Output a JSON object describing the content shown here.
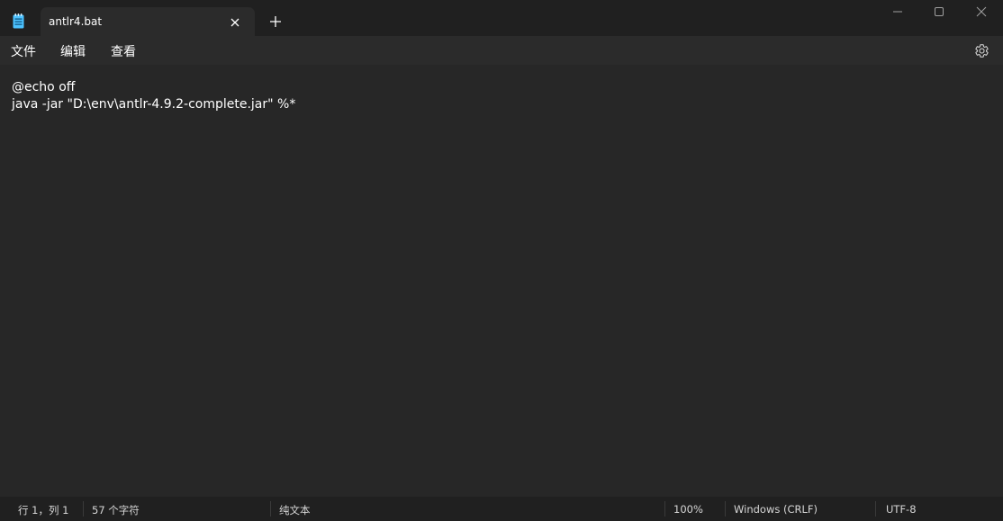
{
  "tab": {
    "title": "antlr4.bat"
  },
  "menu": {
    "file": "文件",
    "edit": "编辑",
    "view": "查看"
  },
  "editor": {
    "lines": [
      "@echo off",
      "java -jar \"D:\\env\\antlr-4.9.2-complete.jar\" %*"
    ]
  },
  "status": {
    "position": "行 1，列 1",
    "char_count": "57 个字符",
    "format": "纯文本",
    "zoom": "100%",
    "line_ending": "Windows (CRLF)",
    "encoding": "UTF-8"
  },
  "icons": {
    "app": "notepad-icon",
    "close_tab": "close-icon",
    "new_tab": "plus-icon",
    "minimize": "minimize-icon",
    "maximize": "maximize-icon",
    "close_window": "close-icon",
    "settings": "gear-icon"
  },
  "colors": {
    "background": "#272727",
    "titlebar": "#202020",
    "tab_active": "#2b2b2b",
    "text": "#ffffff",
    "app_icon_accent": "#4cc2ff"
  }
}
